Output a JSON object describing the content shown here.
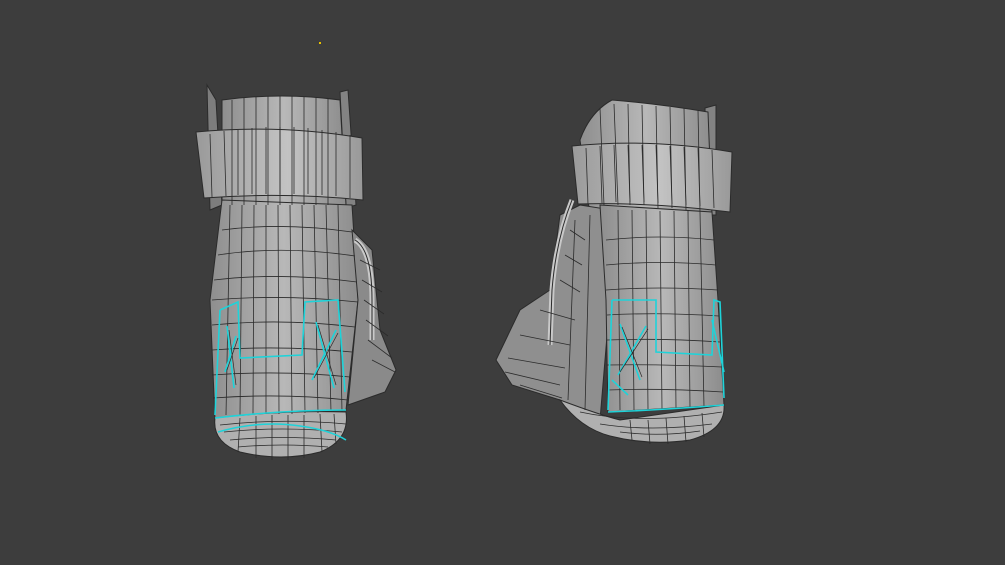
{
  "viewport": {
    "background": "#3d3d3d",
    "mesh_color": "#a9a9a9",
    "wire_color": "#2b2b2b",
    "selection_color": "#1ed3d9",
    "origin_color": "#e8c100"
  },
  "objects": [
    {
      "name": "boot-left-mesh",
      "selected_edges": true
    },
    {
      "name": "boot-right-mesh",
      "selected_edges": true
    }
  ]
}
